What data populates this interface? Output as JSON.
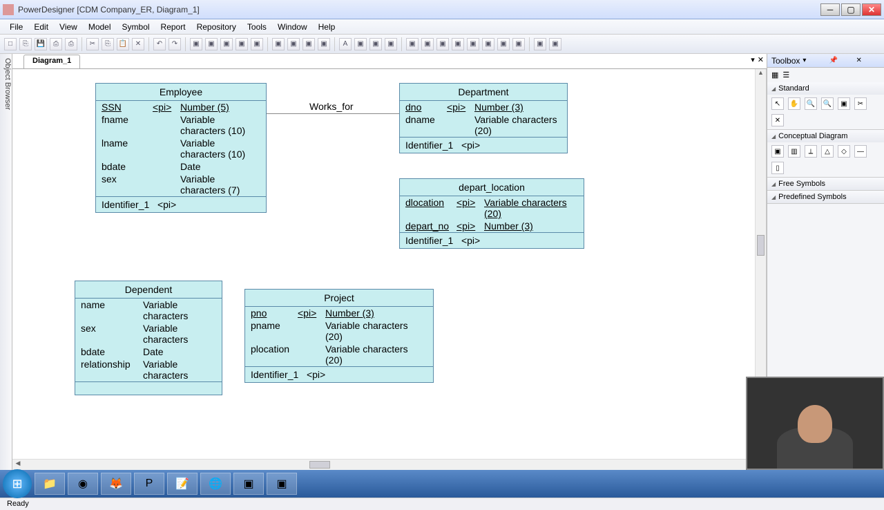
{
  "title": "PowerDesigner [CDM Company_ER, Diagram_1]",
  "menu": [
    "File",
    "Edit",
    "View",
    "Model",
    "Symbol",
    "Report",
    "Repository",
    "Tools",
    "Window",
    "Help"
  ],
  "tab": "Diagram_1",
  "left_panel": "Object Browser",
  "toolbox": {
    "title": "Toolbox",
    "sections": [
      "Standard",
      "Conceptual Diagram",
      "Free Symbols",
      "Predefined Symbols"
    ]
  },
  "status": "Ready",
  "relationship": {
    "label": "Works_for"
  },
  "entities": {
    "employee": {
      "name": "Employee",
      "attrs": [
        {
          "name": "SSN",
          "pi": "<pi>",
          "type": "Number (5)",
          "u": true
        },
        {
          "name": "fname",
          "pi": "",
          "type": "Variable characters (10)"
        },
        {
          "name": "lname",
          "pi": "",
          "type": "Variable characters (10)"
        },
        {
          "name": "bdate",
          "pi": "",
          "type": "Date"
        },
        {
          "name": "sex",
          "pi": "",
          "type": "Variable characters (7)"
        }
      ],
      "identifier": "Identifier_1",
      "id_pi": "<pi>"
    },
    "department": {
      "name": "Department",
      "attrs": [
        {
          "name": "dno",
          "pi": "<pi>",
          "type": "Number (3)",
          "u": true
        },
        {
          "name": "dname",
          "pi": "",
          "type": "Variable characters (20)"
        }
      ],
      "identifier": "Identifier_1",
      "id_pi": "<pi>"
    },
    "depart_location": {
      "name": "depart_location",
      "attrs": [
        {
          "name": "dlocation",
          "pi": "<pi>",
          "type": "Variable characters (20)",
          "u": true
        },
        {
          "name": "depart_no",
          "pi": "<pi>",
          "type": "Number (3)",
          "u": true
        }
      ],
      "identifier": "Identifier_1",
      "id_pi": "<pi>"
    },
    "dependent": {
      "name": "Dependent",
      "attrs": [
        {
          "name": "name",
          "pi": "",
          "type": "Variable characters"
        },
        {
          "name": "sex",
          "pi": "",
          "type": "Variable characters"
        },
        {
          "name": "bdate",
          "pi": "",
          "type": "Date"
        },
        {
          "name": "relationship",
          "pi": "",
          "type": "Variable characters"
        }
      ],
      "identifier": "",
      "id_pi": ""
    },
    "project": {
      "name": "Project",
      "attrs": [
        {
          "name": "pno",
          "pi": "<pi>",
          "type": "Number (3)",
          "u": true
        },
        {
          "name": "pname",
          "pi": "",
          "type": "Variable characters (20)"
        },
        {
          "name": "plocation",
          "pi": "",
          "type": "Variable characters (20)"
        }
      ],
      "identifier": "Identifier_1",
      "id_pi": "<pi>"
    }
  }
}
